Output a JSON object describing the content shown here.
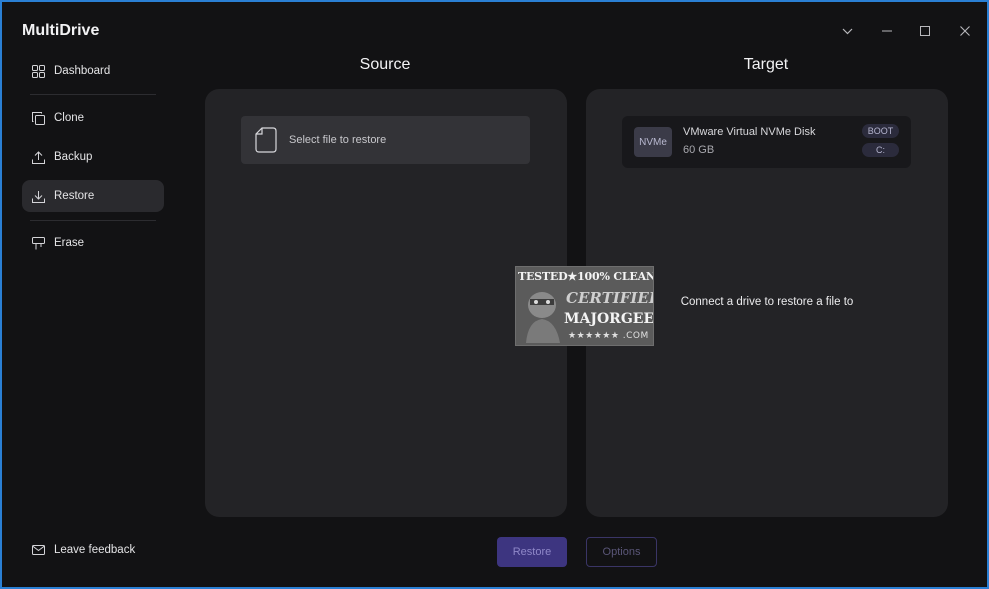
{
  "app": {
    "title": "MultiDrive"
  },
  "window_controls": {
    "menu": "chevron-down",
    "minimize": "minimize",
    "maximize": "maximize",
    "close": "close"
  },
  "sidebar": {
    "items": [
      {
        "label": "Dashboard",
        "icon": "grid-icon"
      },
      {
        "label": "Clone",
        "icon": "copy-icon"
      },
      {
        "label": "Backup",
        "icon": "upload-icon"
      },
      {
        "label": "Restore",
        "icon": "download-icon",
        "active": true
      },
      {
        "label": "Erase",
        "icon": "eraser-icon"
      }
    ],
    "feedback_label": "Leave feedback"
  },
  "source": {
    "heading": "Source",
    "file_picker_label": "Select file to restore"
  },
  "target": {
    "heading": "Target",
    "drive": {
      "badge": "NVMe",
      "name": "VMware Virtual NVMe Disk",
      "size": "60 GB",
      "tags": [
        "BOOT",
        "C:"
      ]
    },
    "message": "Connect a drive to restore a file to"
  },
  "actions": {
    "restore_label": "Restore",
    "options_label": "Options"
  },
  "watermark": {
    "line1": "TESTED★100% CLEAN",
    "line2": "CERTIFIED",
    "line3": "MAJORGEEKS",
    "line4": "★★★★★★ .COM"
  },
  "colors": {
    "background": "#121214",
    "panel": "#232326",
    "accent": "#3d3580",
    "titlebar_border": "#2a7fd4"
  }
}
